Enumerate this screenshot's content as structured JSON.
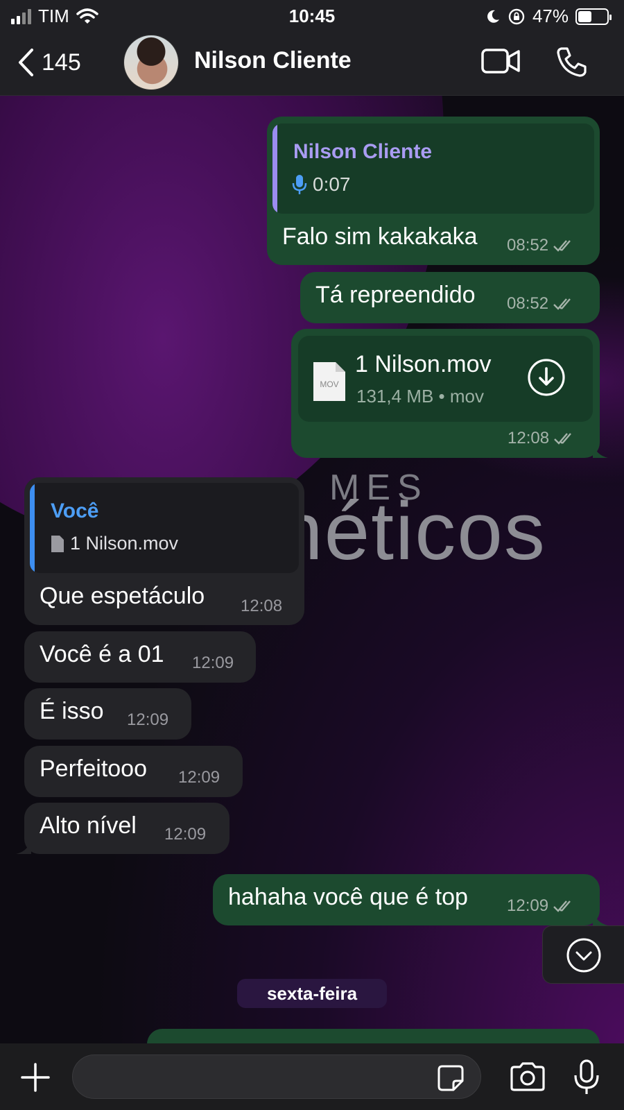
{
  "status_bar": {
    "carrier": "TIM",
    "time": "10:45",
    "battery_percent": "47%",
    "battery_level": 0.47
  },
  "header": {
    "back_count": "145",
    "contact_name": "Nilson Cliente"
  },
  "background": {
    "word_top": "MES",
    "word_main": "néticos"
  },
  "messages": [
    {
      "direction": "out",
      "reply_name": "Nilson Cliente",
      "reply_audio_duration": "0:07",
      "text": "Falo sim kakakaka",
      "time": "08:52"
    },
    {
      "direction": "out",
      "text": "Tá repreendido",
      "time": "08:52"
    },
    {
      "direction": "out",
      "file_name": "1 Nilson.mov",
      "file_meta": "131,4 MB • mov",
      "file_badge": "MOV",
      "time": "12:08"
    },
    {
      "direction": "in",
      "reply_name": "Você",
      "reply_file": "1 Nilson.mov",
      "text": "Que espetáculo",
      "time": "12:08"
    },
    {
      "direction": "in",
      "text": "Você é a 01",
      "time": "12:09"
    },
    {
      "direction": "in",
      "text": "É isso",
      "time": "12:09"
    },
    {
      "direction": "in",
      "text": "Perfeitooo",
      "time": "12:09"
    },
    {
      "direction": "in",
      "text": "Alto nível",
      "time": "12:09"
    },
    {
      "direction": "out",
      "text": "hahaha você que é top",
      "time": "12:09"
    }
  ],
  "date_separator": "sexta-feira",
  "input": {
    "placeholder": ""
  },
  "colors": {
    "outgoing_bubble": "#1c4a2f",
    "incoming_bubble": "#242428",
    "reply_name_out": "#a99cf2",
    "reply_name_in": "#4d9ef5",
    "reply_bar_out": "#9b8cf0",
    "reply_bar_in": "#3d8ef0"
  }
}
